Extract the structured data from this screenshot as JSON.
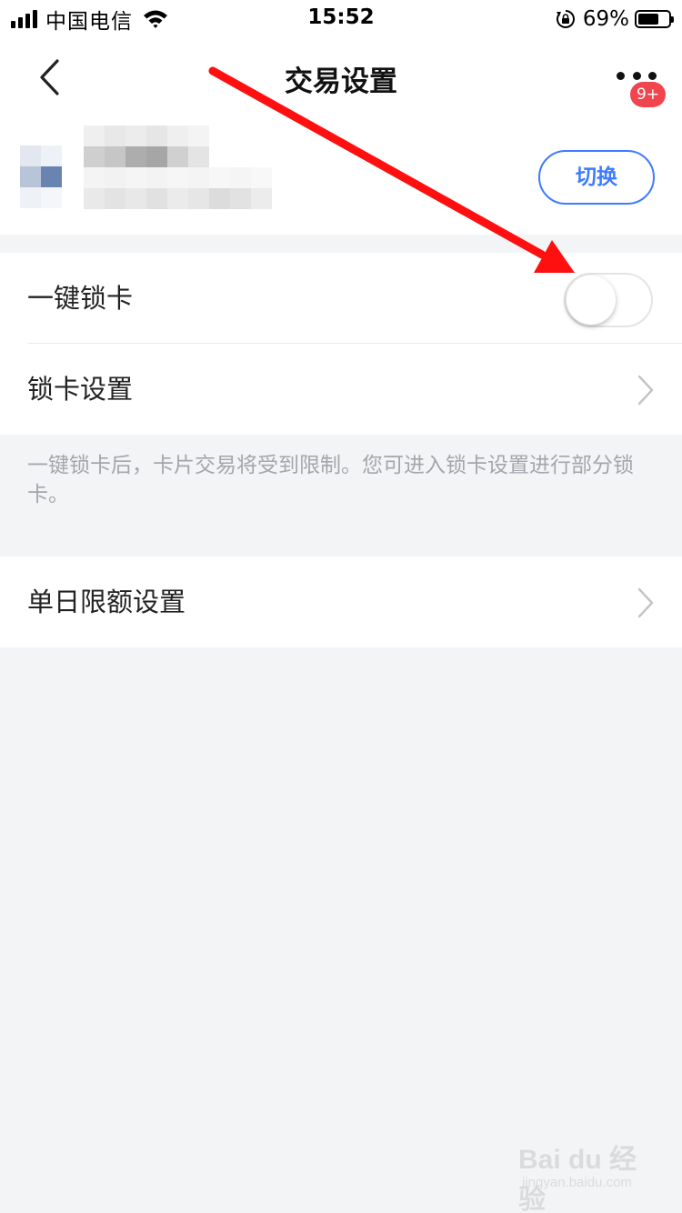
{
  "status_bar": {
    "carrier": "中国电信",
    "time": "15:52",
    "battery_percent": "69%",
    "battery_level": 0.69,
    "icons": [
      "signal-icon",
      "wifi-icon",
      "rotation-lock-icon",
      "battery-icon"
    ]
  },
  "nav": {
    "title": "交易设置",
    "back_icon": "chevron-left-icon",
    "more_icon": "more-dots-icon",
    "badge": "9+"
  },
  "account": {
    "switch_label": "切换"
  },
  "settings": {
    "lock_card_label": "一键锁卡",
    "lock_card_enabled": false,
    "lock_settings_label": "锁卡设置",
    "note": "一键锁卡后，卡片交易将受到限制。您可进入锁卡设置进行部分锁卡。",
    "daily_limit_label": "单日限额设置"
  },
  "watermark": {
    "main": "Bai du 经验",
    "sub": "jingyan.baidu.com"
  },
  "colors": {
    "accent": "#3d7bff",
    "badge": "#f0454f",
    "annotation": "#ff1010",
    "background": "#f3f4f6"
  }
}
